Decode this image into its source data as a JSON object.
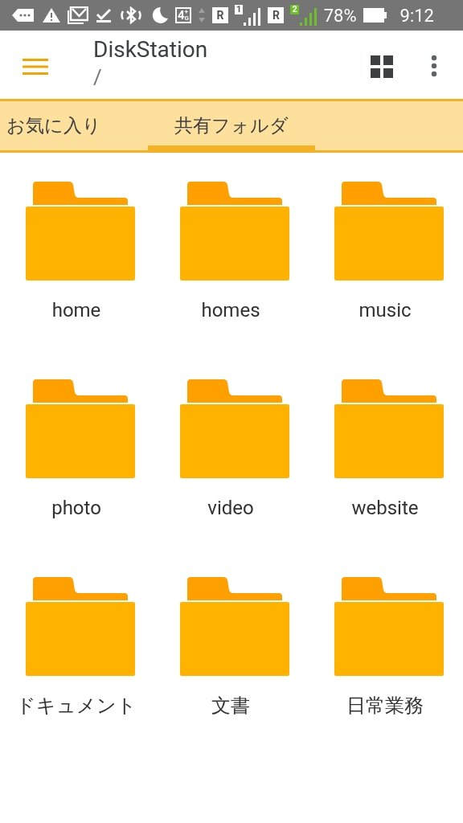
{
  "status_bar": {
    "network": [
      "4",
      "+",
      "G"
    ],
    "sim_1": {
      "roaming": "R",
      "slot": "1"
    },
    "sim_2": {
      "roaming": "R",
      "slot": "2"
    },
    "battery": "78%",
    "time": "9:12"
  },
  "app_bar": {
    "title": "DiskStation",
    "path": "/"
  },
  "tabs": [
    {
      "label": "お気に入り",
      "selected": false
    },
    {
      "label": "共有フォルダ",
      "selected": true
    }
  ],
  "folders": [
    {
      "name": "home"
    },
    {
      "name": "homes"
    },
    {
      "name": "music"
    },
    {
      "name": "photo"
    },
    {
      "name": "video"
    },
    {
      "name": "website"
    },
    {
      "name": "ドキュメント"
    },
    {
      "name": "文書"
    },
    {
      "name": "日常業務"
    }
  ]
}
